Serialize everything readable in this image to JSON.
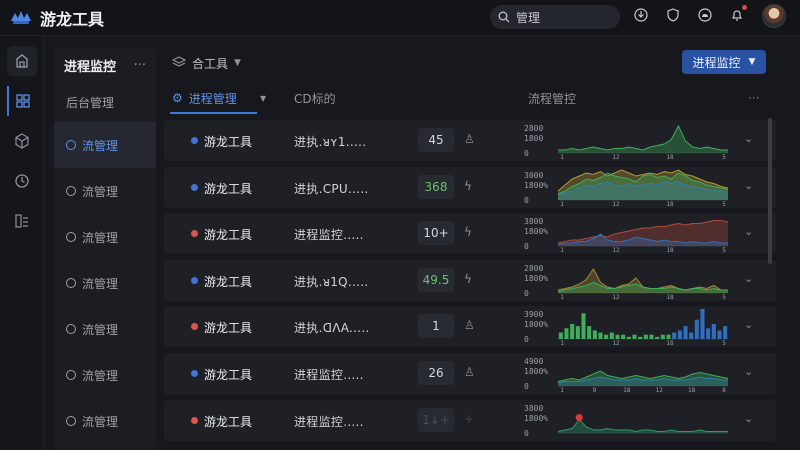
{
  "app": {
    "title": "游龙工具"
  },
  "search": {
    "placeholder": "管理"
  },
  "top_icons": [
    "download-icon",
    "shield-icon",
    "cloud-icon",
    "bell-icon"
  ],
  "rail": [
    "home-icon",
    "dashboard-icon",
    "cube-icon",
    "clock-icon",
    "chart-icon"
  ],
  "subnav": {
    "title": "进程监控",
    "more": "···",
    "items": [
      {
        "label": "后台管理"
      },
      {
        "label": "流管理"
      },
      {
        "label": "流管理"
      },
      {
        "label": "流管理"
      },
      {
        "label": "流管理"
      },
      {
        "label": "流管理"
      },
      {
        "label": "流管理"
      },
      {
        "label": "流管理"
      }
    ]
  },
  "toolbar": {
    "tool_label": "合工具",
    "primary_button": "进程监控"
  },
  "table_header": {
    "tab_label": "进程管理",
    "desc_label": "CD标的",
    "flow_label": "流程管控",
    "more": "···"
  },
  "rows": [
    {
      "name": "游龙工具",
      "desc": "进执.ᴚʏ1.....",
      "badge": "45",
      "status": "♙",
      "dot": "#3f74d8",
      "yl": [
        "2800",
        "1800",
        "0"
      ],
      "xt": [
        "1",
        "12",
        "18",
        "5"
      ],
      "series": [
        {
          "color": "#3fae5a",
          "values": [
            2,
            2,
            3,
            2,
            3,
            4,
            3,
            2,
            3,
            3,
            4,
            3,
            2,
            4,
            5,
            6,
            9,
            18,
            8,
            4,
            3,
            4,
            3,
            2,
            2
          ]
        }
      ]
    },
    {
      "name": "游龙工具",
      "desc": "进执.CPU.....",
      "badge": "368",
      "status": "ϟ",
      "dot": "#3f74d8",
      "badge_style": "green",
      "yl": [
        "3000",
        "1800%",
        "0"
      ],
      "xt": [
        "1",
        "12",
        "18",
        "5"
      ],
      "series": [
        {
          "color": "#b59b36",
          "values": [
            6,
            10,
            14,
            16,
            18,
            17,
            19,
            16,
            18,
            20,
            18,
            16,
            17,
            18,
            17,
            19,
            18,
            20,
            17,
            16,
            14,
            12,
            11,
            9,
            8
          ]
        },
        {
          "color": "#3fae5a",
          "values": [
            4,
            6,
            9,
            11,
            14,
            13,
            15,
            18,
            16,
            15,
            14,
            12,
            16,
            17,
            15,
            16,
            14,
            18,
            16,
            13,
            12,
            10,
            9,
            8,
            7
          ]
        },
        {
          "color": "#2f7fa8",
          "values": [
            3,
            5,
            6,
            8,
            10,
            9,
            11,
            12,
            10,
            9,
            11,
            9,
            10,
            11,
            10,
            12,
            11,
            12,
            10,
            9,
            8,
            7,
            6,
            6,
            5
          ]
        }
      ]
    },
    {
      "name": "游龙工具",
      "desc": "进程监控.....",
      "badge": "10+",
      "status": "ϟ",
      "dot": "#d9574f",
      "yl": [
        "3800",
        "1800%",
        "0"
      ],
      "xt": [
        "1",
        "12",
        "18",
        "5"
      ],
      "series": [
        {
          "color": "#b24a3e",
          "values": [
            2,
            3,
            4,
            4,
            5,
            6,
            7,
            6,
            8,
            9,
            10,
            11,
            12,
            12,
            13,
            13,
            14,
            15,
            14,
            15,
            15,
            16,
            17,
            17,
            16
          ]
        },
        {
          "color": "#2f6fb8",
          "values": [
            1,
            2,
            2,
            3,
            3,
            5,
            8,
            4,
            3,
            3,
            4,
            6,
            5,
            4,
            3,
            4,
            3,
            3,
            2,
            3,
            2,
            2,
            3,
            2,
            2
          ]
        }
      ]
    },
    {
      "name": "游龙工具",
      "desc": "进执.ᴚ1Q.....",
      "badge": "49.5",
      "status": "ϟ",
      "dot": "#3f74d8",
      "badge_style": "green",
      "yl": [
        "2800",
        "1800%",
        "0"
      ],
      "xt": [
        "1",
        "12",
        "18",
        "5"
      ],
      "series": [
        {
          "color": "#a78a33",
          "values": [
            2,
            3,
            4,
            6,
            9,
            16,
            7,
            4,
            3,
            5,
            6,
            10,
            4,
            3,
            3,
            4,
            5,
            3,
            2,
            3,
            4,
            3,
            5,
            2,
            2
          ]
        },
        {
          "color": "#3fae5a",
          "values": [
            1,
            2,
            3,
            4,
            5,
            7,
            5,
            3,
            3,
            4,
            5,
            6,
            4,
            3,
            3,
            3,
            4,
            3,
            2,
            3,
            3,
            2,
            3,
            2,
            2
          ]
        }
      ]
    },
    {
      "name": "游龙工具",
      "desc": "进执.ᗡɅA.....",
      "badge": "1",
      "status": "♙",
      "dot": "#d9574f",
      "yl": [
        "3900",
        "1800%",
        "0"
      ],
      "xt": [
        "1",
        "12",
        "18",
        "5"
      ],
      "bars": [
        {
          "color": "#3fae5a",
          "values": [
            3,
            5,
            7,
            6,
            12,
            6,
            4,
            3,
            2,
            3,
            2,
            2,
            1,
            2,
            1,
            2,
            2,
            1,
            2,
            2,
            3,
            4,
            6,
            3,
            9,
            14,
            5,
            7,
            4,
            6
          ]
        }
      ],
      "bar_split": 20
    },
    {
      "name": "游龙工具",
      "desc": "进程监控.....",
      "badge": "26",
      "status": "♙",
      "dot": "#3f74d8",
      "yl": [
        "4900",
        "1800%",
        "0"
      ],
      "xt": [
        "1",
        "9",
        "18",
        "12",
        "18",
        "8"
      ],
      "series": [
        {
          "color": "#3fae5a",
          "values": [
            3,
            4,
            5,
            4,
            6,
            8,
            10,
            7,
            6,
            5,
            6,
            7,
            6,
            5,
            6,
            7,
            6,
            5,
            6,
            8,
            9,
            8,
            7,
            6,
            5
          ]
        },
        {
          "color": "#2f7fa8",
          "values": [
            2,
            3,
            3,
            3,
            4,
            5,
            6,
            5,
            4,
            4,
            4,
            5,
            4,
            4,
            4,
            5,
            4,
            4,
            4,
            5,
            6,
            5,
            5,
            4,
            4
          ]
        }
      ]
    },
    {
      "name": "游龙工具",
      "desc": "进程监控.....",
      "badge": "1↓+",
      "status": "+",
      "dot": "#d9574f",
      "badge_style": "faded",
      "status_style": "faded",
      "yl": [
        "3800",
        "1800%",
        "0"
      ],
      "xt": [],
      "peak_dot": "#d93b3b",
      "series": [
        {
          "color": "#2f9a6a",
          "values": [
            1,
            2,
            3,
            9,
            4,
            2,
            2,
            3,
            2,
            2,
            2,
            1,
            2,
            2,
            1,
            1,
            2,
            1,
            1,
            1,
            2,
            1,
            1,
            1,
            1
          ]
        }
      ]
    }
  ]
}
